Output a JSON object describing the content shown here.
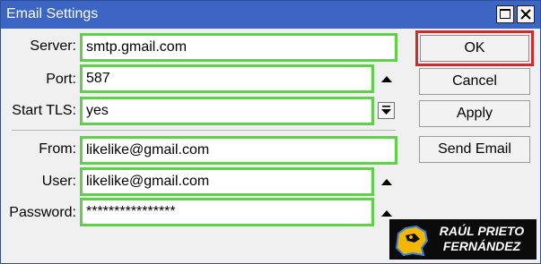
{
  "window": {
    "title": "Email Settings"
  },
  "form": {
    "server": {
      "label": "Server:",
      "value": "smtp.gmail.com"
    },
    "port": {
      "label": "Port:",
      "value": "587"
    },
    "start_tls": {
      "label": "Start TLS:",
      "value": "yes"
    },
    "from": {
      "label": "From:",
      "value": "likelike@gmail.com"
    },
    "user": {
      "label": "User:",
      "value": "likelike@gmail.com"
    },
    "password": {
      "label": "Password:",
      "value": "****************"
    }
  },
  "buttons": {
    "ok": "OK",
    "cancel": "Cancel",
    "apply": "Apply",
    "send_email": "Send Email"
  },
  "watermark": {
    "text": "RAÚL PRIETO FERNÁNDEZ"
  },
  "colors": {
    "titlebar": "#3c65c4",
    "field_highlight": "#5fd04a",
    "ok_highlight": "#d02b2b"
  },
  "icons": {
    "port_toggle": "up-arrow-icon",
    "start_tls_dropdown": "dropdown-arrow-icon",
    "user_toggle": "up-arrow-icon",
    "password_toggle": "up-arrow-icon"
  }
}
